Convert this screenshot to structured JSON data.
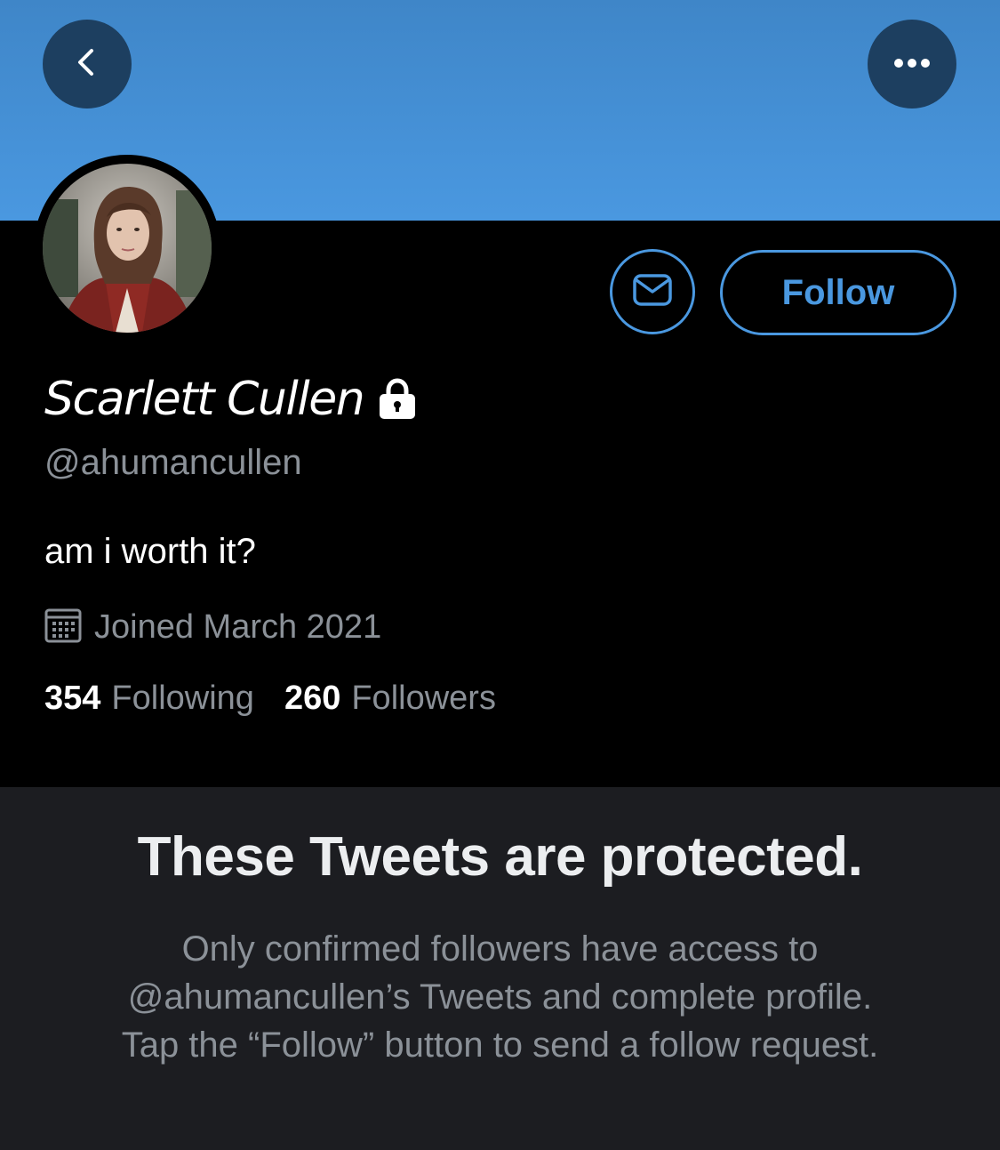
{
  "header": {
    "back_icon": "chevron-left-icon",
    "more_icon": "more-horizontal-icon",
    "banner_color": "#4a98e0"
  },
  "profile": {
    "display_name": "Scarlett Cullen",
    "protected_icon": "lock-icon",
    "handle": "@ahumancullen",
    "bio": "am i worth it?",
    "joined_icon": "calendar-icon",
    "joined": "Joined March 2021",
    "following_count": "354",
    "following_label": "Following",
    "followers_count": "260",
    "followers_label": "Followers"
  },
  "actions": {
    "message_icon": "envelope-icon",
    "follow_label": "Follow",
    "accent_color": "#4a98e0"
  },
  "protected_notice": {
    "title": "These Tweets are protected.",
    "lines": [
      "Only confirmed followers have access to",
      "@ahumancullen’s Tweets and complete profile.",
      "Tap the “Follow” button to send a follow request."
    ]
  }
}
